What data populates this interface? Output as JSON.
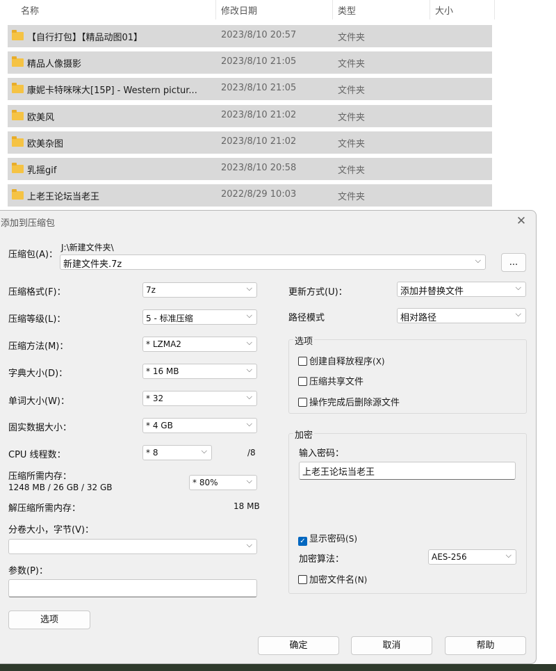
{
  "explorer": {
    "columns": {
      "name": "名称",
      "modified": "修改日期",
      "type": "类型",
      "size": "大小"
    },
    "files": [
      {
        "name": "【自行打包】【精品动图01】",
        "date": "2023/8/10 20:57",
        "type": "文件夹"
      },
      {
        "name": "精品人像摄影",
        "date": "2023/8/10 21:05",
        "type": "文件夹"
      },
      {
        "name": "康妮卡特咪咪大[15P] - Western pictur...",
        "date": "2023/8/10 21:05",
        "type": "文件夹"
      },
      {
        "name": "欧美风",
        "date": "2023/8/10 21:02",
        "type": "文件夹"
      },
      {
        "name": "欧美杂图",
        "date": "2023/8/10 21:02",
        "type": "文件夹"
      },
      {
        "name": "乳摇gif",
        "date": "2023/8/10 20:58",
        "type": "文件夹"
      },
      {
        "name": "上老王论坛当老王",
        "date": "2022/8/29 10:03",
        "type": "文件夹"
      }
    ]
  },
  "dialog": {
    "title": "添加到压缩包",
    "archive": {
      "label": "压缩包(A)：",
      "path": "J:\\新建文件夹\\",
      "value": "新建文件夹.7z",
      "browse_label": "..."
    },
    "left": {
      "format": {
        "label": "压缩格式(F)：",
        "value": "7z"
      },
      "level": {
        "label": "压缩等级(L)：",
        "value": "5 - 标准压缩"
      },
      "method": {
        "label": "压缩方法(M)：",
        "value": "* LZMA2"
      },
      "dict": {
        "label": "字典大小(D)：",
        "value": "* 16 MB"
      },
      "word": {
        "label": "单词大小(W)：",
        "value": "* 32"
      },
      "solid": {
        "label": "固实数据大小：",
        "value": "* 4 GB"
      },
      "cpu": {
        "label": "CPU 线程数：",
        "value": "* 8",
        "max": "/8"
      },
      "mem": {
        "label": "压缩所需内存：",
        "detail": "1248 MB / 26 GB / 32 GB",
        "value": "* 80%"
      },
      "decomp": {
        "label": "解压缩所需内存：",
        "value": "18 MB"
      },
      "volume": {
        "label": "分卷大小，字节(V)：",
        "value": ""
      },
      "params": {
        "label": "参数(P)：",
        "value": ""
      },
      "options_button": "选项"
    },
    "right": {
      "update": {
        "label": "更新方式(U)：",
        "value": "添加并替换文件"
      },
      "path_mode": {
        "label": "路径模式",
        "value": "相对路径"
      },
      "options": {
        "title": "选项",
        "sfx": {
          "label": "创建自释放程序",
          "hotkey": "(X)",
          "checked": false
        },
        "shared": {
          "label": "压缩共享文件",
          "checked": false
        },
        "delete": {
          "label": "操作完成后删除源文件",
          "checked": false
        }
      },
      "encryption": {
        "title": "加密",
        "password_label": "输入密码：",
        "password_value": "上老王论坛当老王",
        "show_password": {
          "label": "显示密码",
          "hotkey": "(S)",
          "checked": true
        },
        "method_label": "加密算法：",
        "method_value": "AES-256",
        "encrypt_names": {
          "label": "加密文件名",
          "hotkey": "(N)",
          "checked": false
        }
      }
    },
    "buttons": {
      "ok": "确定",
      "cancel": "取消",
      "help": "帮助"
    }
  }
}
